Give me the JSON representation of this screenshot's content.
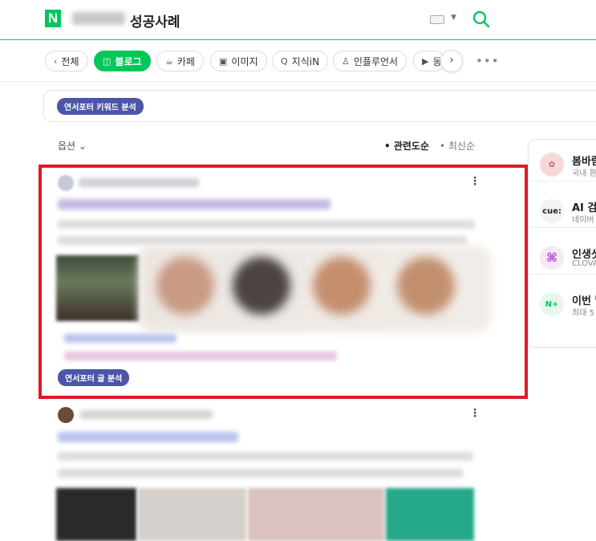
{
  "header": {
    "logo_letter": "N",
    "query_suffix": "성공사례"
  },
  "tabs": [
    {
      "label": "전체",
      "icon": "chevron-left-icon"
    },
    {
      "label": "블로그",
      "icon": "blog-icon",
      "active": true
    },
    {
      "label": "카페",
      "icon": "cafe-icon"
    },
    {
      "label": "이미지",
      "icon": "image-icon"
    },
    {
      "label": "지식iN",
      "icon": "q-icon"
    },
    {
      "label": "인플루언서",
      "icon": "person-icon"
    },
    {
      "label": "동",
      "icon": "play-icon"
    }
  ],
  "keyword_pill": "연서포터 키워드 분석",
  "options": {
    "label": "옵션",
    "sort_relevance": "• 관련도순",
    "sort_recent": "• 최신순"
  },
  "card1": {
    "tag_pill": "연서포터 글 분석"
  },
  "sidebar": [
    {
      "title": "봄바람",
      "sub": "국내 환",
      "icon": "flower-icon",
      "color": "#f7d8d8"
    },
    {
      "title": "AI 검색",
      "sub": "네이버",
      "icon": "cue-icon",
      "color": "#f2f2f2",
      "icon_text": "cue:"
    },
    {
      "title": "인생샷",
      "sub": "CLOVA",
      "icon": "clova-icon",
      "color": "#f7e8f7"
    },
    {
      "title": "이번 달",
      "sub": "최대 5",
      "icon": "naver-plus-icon",
      "color": "#e6f8ee",
      "icon_text": "N+"
    }
  ],
  "colors": {
    "accent": "#03c75a",
    "highlight_border": "#e01a22",
    "pill": "#4b56a8"
  }
}
